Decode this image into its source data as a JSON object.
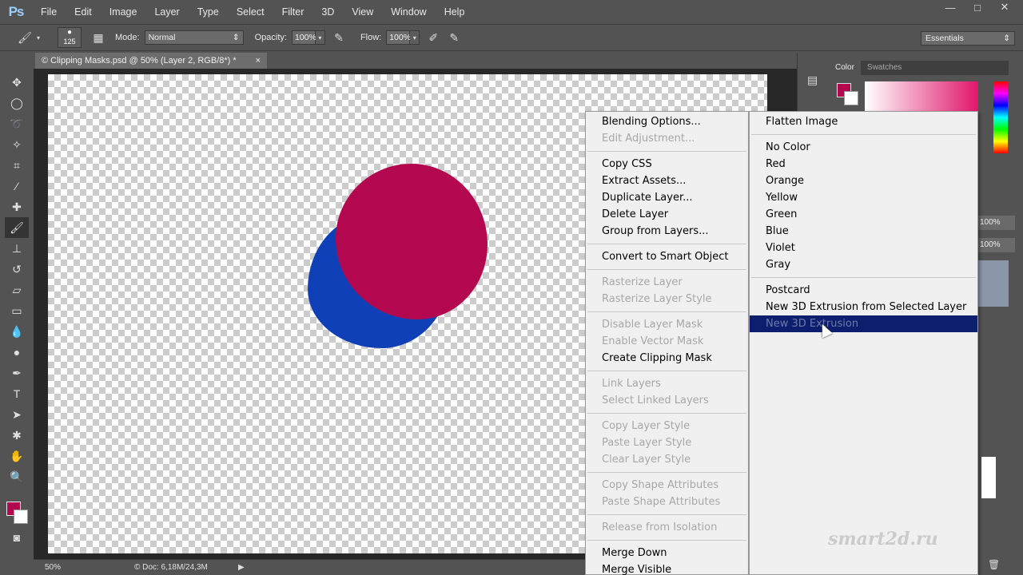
{
  "app": {
    "logo": "Ps"
  },
  "menubar": {
    "items": [
      "File",
      "Edit",
      "Image",
      "Layer",
      "Type",
      "Select",
      "Filter",
      "3D",
      "View",
      "Window",
      "Help"
    ],
    "window_controls": [
      "—",
      "□",
      "✕"
    ]
  },
  "options": {
    "brush_size": "125",
    "mode_label": "Mode:",
    "mode_value": "Normal",
    "opacity_label": "Opacity:",
    "opacity_value": "100%",
    "flow_label": "Flow:",
    "flow_value": "100%",
    "workspace": "Essentials"
  },
  "document": {
    "tab_title": "© Clipping Masks.psd @ 50% (Layer 2, RGB/8*) *",
    "tab_close": "×"
  },
  "status": {
    "zoom": "50%",
    "doc_info": "© Doc: 6,18M/24,3M"
  },
  "panels": {
    "color_tab": "Color",
    "swatches_tab": "Swatches",
    "fg_color": "#b3084f",
    "opacity_right_1": "100%",
    "opacity_right_2": "100%"
  },
  "context_menu": {
    "items": [
      {
        "label": "Blending Options...",
        "enabled": true
      },
      {
        "label": "Edit Adjustment...",
        "enabled": false
      },
      {
        "sep": true
      },
      {
        "label": "Copy CSS",
        "enabled": true
      },
      {
        "label": "Extract Assets...",
        "enabled": true
      },
      {
        "label": "Duplicate Layer...",
        "enabled": true
      },
      {
        "label": "Delete Layer",
        "enabled": true
      },
      {
        "label": "Group from Layers...",
        "enabled": true
      },
      {
        "sep": true
      },
      {
        "label": "Convert to Smart Object",
        "enabled": true
      },
      {
        "sep": true
      },
      {
        "label": "Rasterize Layer",
        "enabled": false
      },
      {
        "label": "Rasterize Layer Style",
        "enabled": false
      },
      {
        "sep": true
      },
      {
        "label": "Disable Layer Mask",
        "enabled": false
      },
      {
        "label": "Enable Vector Mask",
        "enabled": false
      },
      {
        "label": "Create Clipping Mask",
        "enabled": true
      },
      {
        "sep": true
      },
      {
        "label": "Link Layers",
        "enabled": false
      },
      {
        "label": "Select Linked Layers",
        "enabled": false
      },
      {
        "sep": true
      },
      {
        "label": "Copy Layer Style",
        "enabled": false
      },
      {
        "label": "Paste Layer Style",
        "enabled": false
      },
      {
        "label": "Clear Layer Style",
        "enabled": false
      },
      {
        "sep": true
      },
      {
        "label": "Copy Shape Attributes",
        "enabled": false
      },
      {
        "label": "Paste Shape Attributes",
        "enabled": false
      },
      {
        "sep": true
      },
      {
        "label": "Release from Isolation",
        "enabled": false
      },
      {
        "sep": true
      },
      {
        "label": "Merge Down",
        "enabled": true
      },
      {
        "label": "Merge Visible",
        "enabled": true
      }
    ]
  },
  "submenu": {
    "items": [
      {
        "label": "Flatten Image",
        "enabled": true
      },
      {
        "sep": true
      },
      {
        "label": "No Color",
        "enabled": true
      },
      {
        "label": "Red",
        "enabled": true
      },
      {
        "label": "Orange",
        "enabled": true
      },
      {
        "label": "Yellow",
        "enabled": true
      },
      {
        "label": "Green",
        "enabled": true
      },
      {
        "label": "Blue",
        "enabled": true
      },
      {
        "label": "Violet",
        "enabled": true
      },
      {
        "label": "Gray",
        "enabled": true
      },
      {
        "sep": true
      },
      {
        "label": "Postcard",
        "enabled": true
      },
      {
        "label": "New 3D Extrusion from Selected Layer",
        "enabled": true
      },
      {
        "label": "New 3D Extrusion",
        "enabled": false,
        "highlighted": true
      }
    ]
  },
  "watermark": "smart2d.ru"
}
